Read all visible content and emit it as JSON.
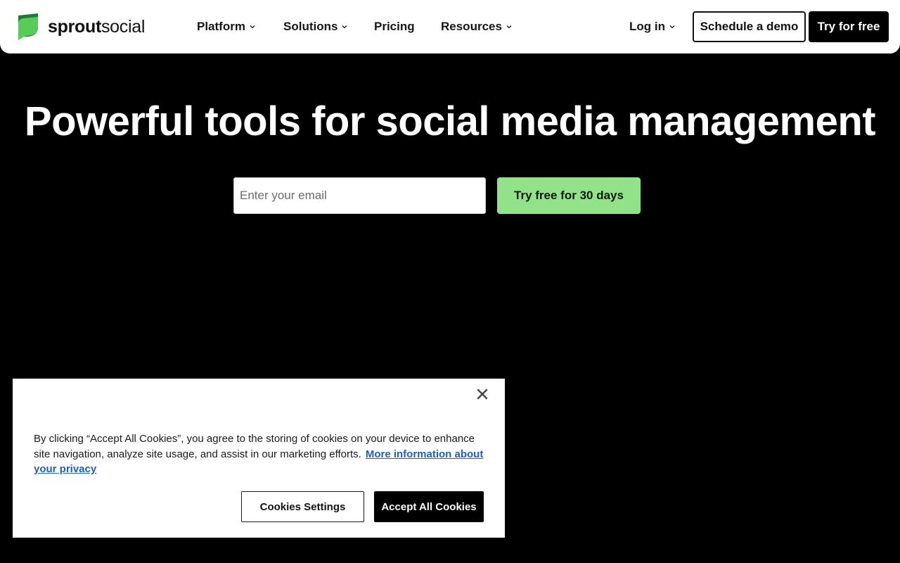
{
  "header": {
    "logo": {
      "word1": "sprout",
      "word2": "social",
      "icon": "sprout-leaf-logo"
    },
    "nav": [
      {
        "label": "Platform",
        "has_dropdown": true
      },
      {
        "label": "Solutions",
        "has_dropdown": true
      },
      {
        "label": "Pricing",
        "has_dropdown": false
      },
      {
        "label": "Resources",
        "has_dropdown": true
      }
    ],
    "login": {
      "label": "Log in",
      "has_dropdown": true
    },
    "demo_button": "Schedule a demo",
    "try_button": "Try for free"
  },
  "hero": {
    "title": "Powerful tools for social media management",
    "email_placeholder": "Enter your email",
    "email_value": "",
    "cta_button": "Try free for 30 days"
  },
  "cookie_banner": {
    "text": "By clicking “Accept All Cookies”, you agree to the storing of cookies on your device to enhance site navigation, analyze site usage, and assist in our marketing efforts.",
    "link": "More information about your privacy",
    "settings_button": "Cookies Settings",
    "accept_button": "Accept All Cookies",
    "close_icon": "close-icon"
  },
  "colors": {
    "page_bg": "#000000",
    "header_bg": "#ffffff",
    "cta_green": "#92e28a",
    "link_blue": "#1f5fbf",
    "logo_green_dark": "#1f7a3a",
    "logo_green_light": "#59cb59"
  }
}
